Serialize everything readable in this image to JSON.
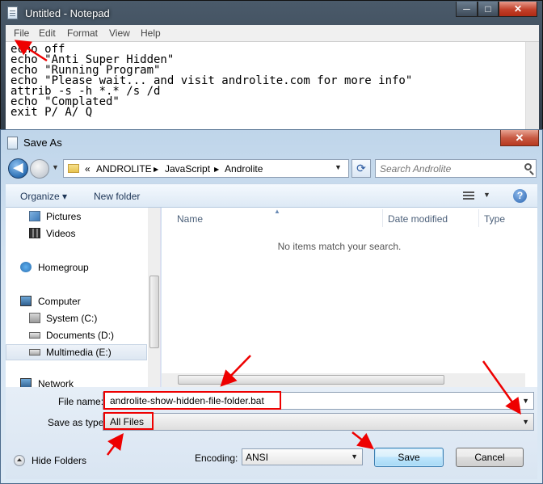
{
  "notepad": {
    "title": "Untitled - Notepad",
    "caption_buttons": {
      "minimize": "─",
      "maximize": "□",
      "close": "✕"
    },
    "menu": [
      "File",
      "Edit",
      "Format",
      "View",
      "Help"
    ],
    "lines": [
      "echo off",
      "echo \"Anti Super Hidden\"",
      "echo \"Running Program\"",
      "echo \"Please wait... and visit androlite.com for more info\"",
      "attrib -s -h *.* /s /d",
      "echo \"Complated\"",
      "exit P/ A/ Q"
    ]
  },
  "dialog": {
    "title": "Save As",
    "close": "✕",
    "breadcrumb": [
      "«",
      "ANDROLITE",
      "▶",
      "JavaScript",
      "▶",
      "Androlite"
    ],
    "search_placeholder": "Search Androlite",
    "toolbar": {
      "organize": "Organize ▾",
      "new_folder": "New folder"
    },
    "nav_items": [
      {
        "label": "Pictures",
        "icon": "pictures-icon"
      },
      {
        "label": "Videos",
        "icon": "videos-icon"
      },
      {
        "label": "Homegroup",
        "icon": "homegroup-icon"
      },
      {
        "label": "Computer",
        "icon": "computer-icon"
      },
      {
        "label": "System (C:)",
        "icon": "system-drive-icon"
      },
      {
        "label": "Documents (D:)",
        "icon": "drive-icon"
      },
      {
        "label": "Multimedia (E:)",
        "icon": "drive-icon"
      },
      {
        "label": "Network",
        "icon": "network-icon"
      }
    ],
    "columns": [
      "Name",
      "Date modified",
      "Type"
    ],
    "empty_message": "No items match your search.",
    "file_name_label": "File name:",
    "file_name_value": "androlite-show-hidden-file-folder.bat",
    "save_type_label": "Save as type:",
    "save_type_value": "All Files",
    "hide_folders": "Hide Folders",
    "encoding_label": "Encoding:",
    "encoding_value": "ANSI",
    "save_button": "Save",
    "cancel_button": "Cancel"
  },
  "colors": {
    "annotation": "#e00000",
    "accent": "#2c6fb3"
  }
}
